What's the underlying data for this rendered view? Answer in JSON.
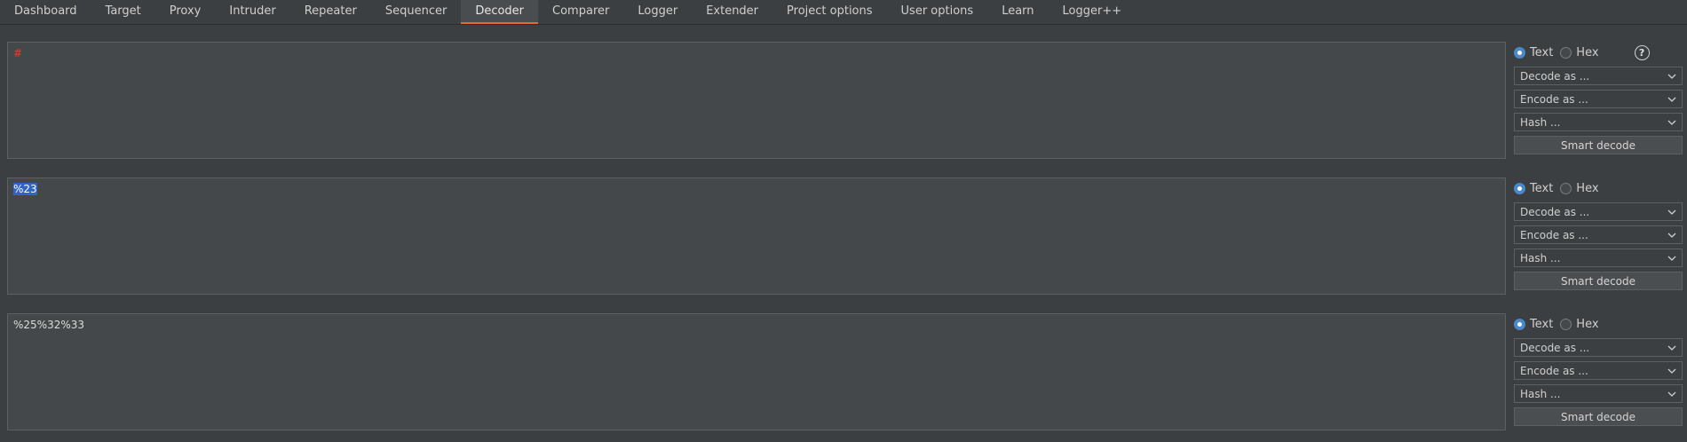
{
  "tabs": [
    {
      "label": "Dashboard"
    },
    {
      "label": "Target"
    },
    {
      "label": "Proxy"
    },
    {
      "label": "Intruder"
    },
    {
      "label": "Repeater"
    },
    {
      "label": "Sequencer"
    },
    {
      "label": "Decoder",
      "active": true
    },
    {
      "label": "Comparer"
    },
    {
      "label": "Logger"
    },
    {
      "label": "Extender"
    },
    {
      "label": "Project options"
    },
    {
      "label": "User options"
    },
    {
      "label": "Learn"
    },
    {
      "label": "Logger++"
    }
  ],
  "panels": [
    {
      "content": "#",
      "mode_text": "Text",
      "mode_hex": "Hex",
      "selected_mode": "Text",
      "decode_label": "Decode as ...",
      "encode_label": "Encode as ...",
      "hash_label": "Hash ...",
      "smart_decode_label": "Smart decode",
      "help_label": "?"
    },
    {
      "content": "%23",
      "mode_text": "Text",
      "mode_hex": "Hex",
      "selected_mode": "Text",
      "decode_label": "Decode as ...",
      "encode_label": "Encode as ...",
      "hash_label": "Hash ...",
      "smart_decode_label": "Smart decode"
    },
    {
      "content": "%25%32%33",
      "mode_text": "Text",
      "mode_hex": "Hex",
      "selected_mode": "Text",
      "decode_label": "Decode as ...",
      "encode_label": "Encode as ...",
      "hash_label": "Hash ...",
      "smart_decode_label": "Smart decode"
    }
  ],
  "colors": {
    "accent_tab_underline": "#e8692b",
    "radio_checked": "#4a88c7",
    "selection": "#2f65ca"
  }
}
